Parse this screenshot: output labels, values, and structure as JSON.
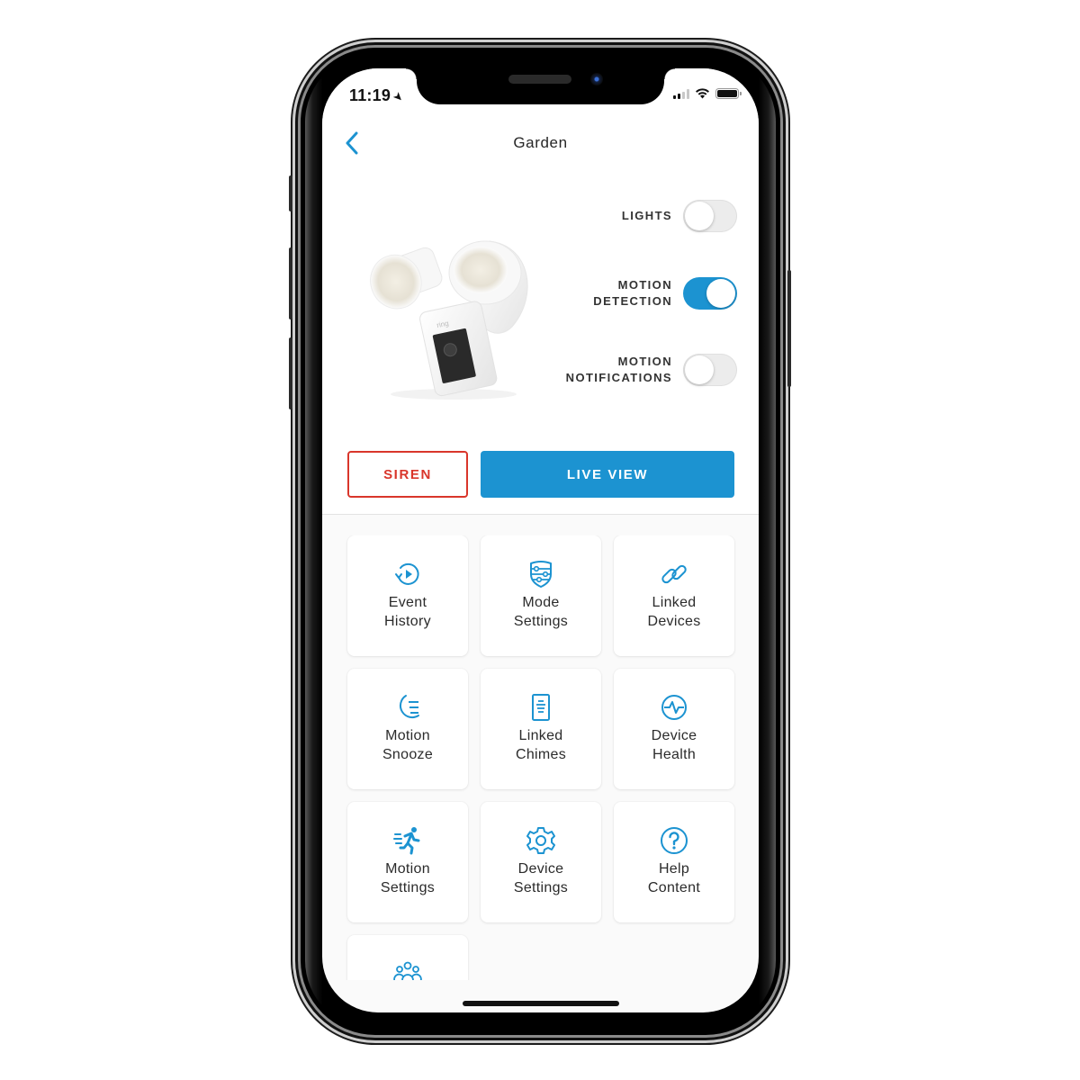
{
  "status_bar": {
    "time": "11:19",
    "location_icon": "location-arrow-icon",
    "signal_bars_filled": 2,
    "signal_bars_total": 4,
    "wifi_icon": "wifi-icon",
    "battery_level": 1.0
  },
  "header": {
    "back_icon": "chevron-left-icon",
    "title": "Garden"
  },
  "device": {
    "image": "floodlight-camera-image",
    "brand_mark": "ring"
  },
  "toggles": [
    {
      "label_line1": "LIGHTS",
      "label_line2": "",
      "on": false
    },
    {
      "label_line1": "MOTION",
      "label_line2": "DETECTION",
      "on": true
    },
    {
      "label_line1": "MOTION",
      "label_line2": "NOTIFICATIONS",
      "on": false
    }
  ],
  "actions": {
    "siren_label": "SIREN",
    "live_view_label": "LIVE VIEW"
  },
  "tiles": [
    {
      "icon": "event-history-icon",
      "line1": "Event",
      "line2": "History"
    },
    {
      "icon": "mode-settings-icon",
      "line1": "Mode",
      "line2": "Settings"
    },
    {
      "icon": "linked-devices-icon",
      "line1": "Linked",
      "line2": "Devices"
    },
    {
      "icon": "motion-snooze-icon",
      "line1": "Motion",
      "line2": "Snooze"
    },
    {
      "icon": "linked-chimes-icon",
      "line1": "Linked",
      "line2": "Chimes"
    },
    {
      "icon": "device-health-icon",
      "line1": "Device",
      "line2": "Health"
    },
    {
      "icon": "motion-settings-icon",
      "line1": "Motion",
      "line2": "Settings"
    },
    {
      "icon": "device-settings-icon",
      "line1": "Device",
      "line2": "Settings"
    },
    {
      "icon": "help-content-icon",
      "line1": "Help",
      "line2": "Content"
    },
    {
      "icon": "shared-users-icon",
      "line1": "",
      "line2": ""
    }
  ],
  "colors": {
    "accent": "#1c93d1",
    "siren": "#d9362b",
    "text": "#2b2b2b",
    "grid_bg": "#fafafa"
  }
}
